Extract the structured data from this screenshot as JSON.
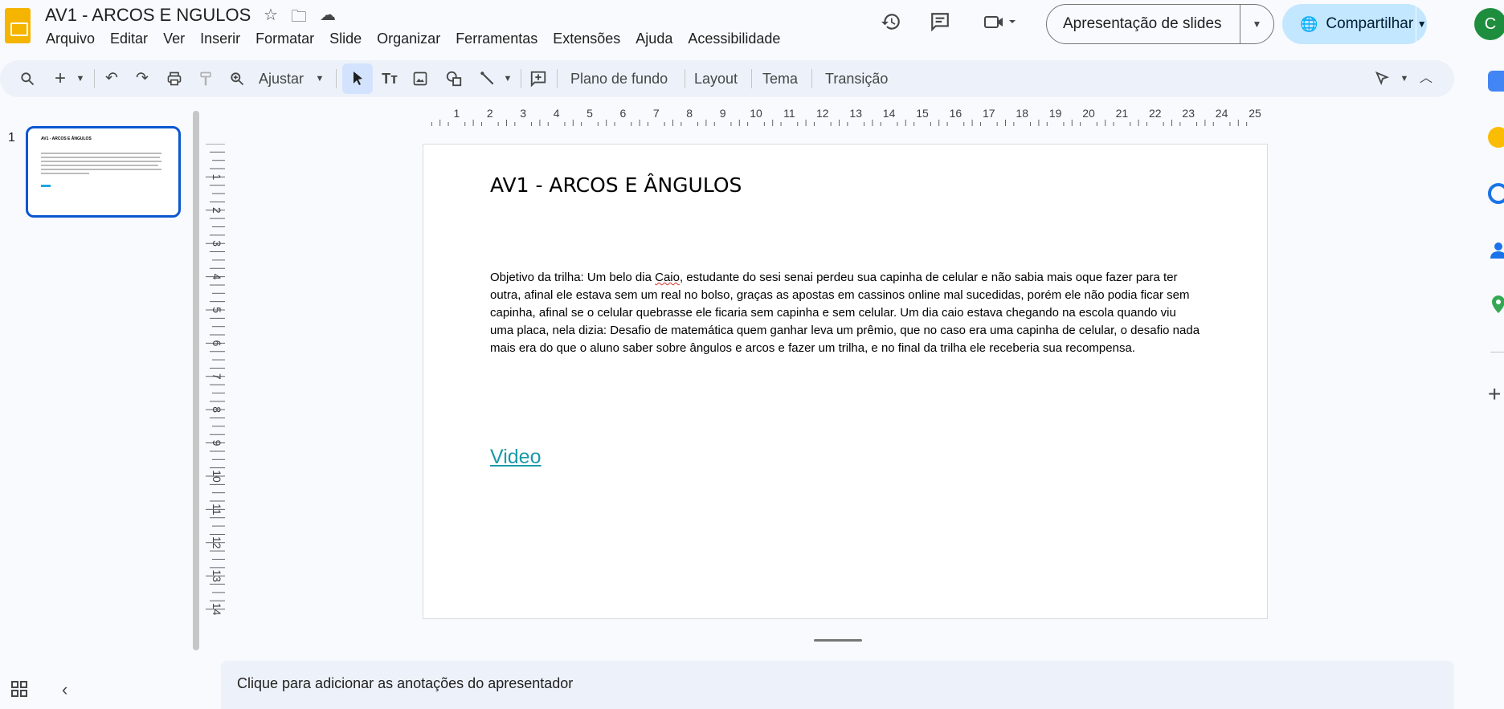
{
  "app": {
    "title": "AV1 - ARCOS E  NGULOS",
    "menu": [
      "Arquivo",
      "Editar",
      "Ver",
      "Inserir",
      "Formatar",
      "Slide",
      "Organizar",
      "Ferramentas",
      "Extensões",
      "Ajuda",
      "Acessibilidade"
    ],
    "present_label": "Apresentação de slides",
    "share_label": "Compartilhar",
    "avatar_letter": "C"
  },
  "toolbar": {
    "zoom_label": "Ajustar",
    "background_label": "Plano de fundo",
    "layout_label": "Layout",
    "theme_label": "Tema",
    "transition_label": "Transição"
  },
  "ruler": {
    "top_numbers": [
      "1",
      "2",
      "3",
      "4",
      "5",
      "6",
      "7",
      "8",
      "9",
      "10",
      "11",
      "12",
      "13",
      "14",
      "15",
      "16",
      "17",
      "18",
      "19",
      "20",
      "21",
      "22",
      "23",
      "24",
      "25"
    ],
    "left_numbers": [
      "1",
      "2",
      "3",
      "4",
      "5",
      "6",
      "7",
      "8",
      "9",
      "10",
      "11",
      "12",
      "13",
      "14"
    ]
  },
  "filmstrip": {
    "slide_number": "1"
  },
  "slide": {
    "title": "AV1 - ARCOS E ÂNGULOS",
    "body_before": "Objetivo da trilha: Um belo dia ",
    "body_misspelled": "Caio",
    "body_after": ", estudante do sesi senai perdeu sua capinha de celular e não sabia mais oque fazer para ter outra, afinal ele estava sem um real no bolso, graças as apostas em cassinos online mal sucedidas, porém ele não podia ficar sem capinha, afinal se o celular quebrasse ele ficaria sem capinha e sem celular. Um dia caio estava chegando na escola quando viu uma placa, nela dizia: Desafio de matemática quem ganhar leva um prêmio, que no caso era uma capinha de celular, o desafio nada mais era do que o aluno saber sobre ângulos e arcos e fazer um trilha, e no final da trilha ele receberia sua recompensa.",
    "link_text": "Video"
  },
  "notes": {
    "placeholder": "Clique para adicionar as anotações do apresentador"
  },
  "colors": {
    "accent": "#0b57d0",
    "share_bg": "#c2e7ff",
    "link": "#1a9aa8",
    "logo": "#f4b400"
  }
}
